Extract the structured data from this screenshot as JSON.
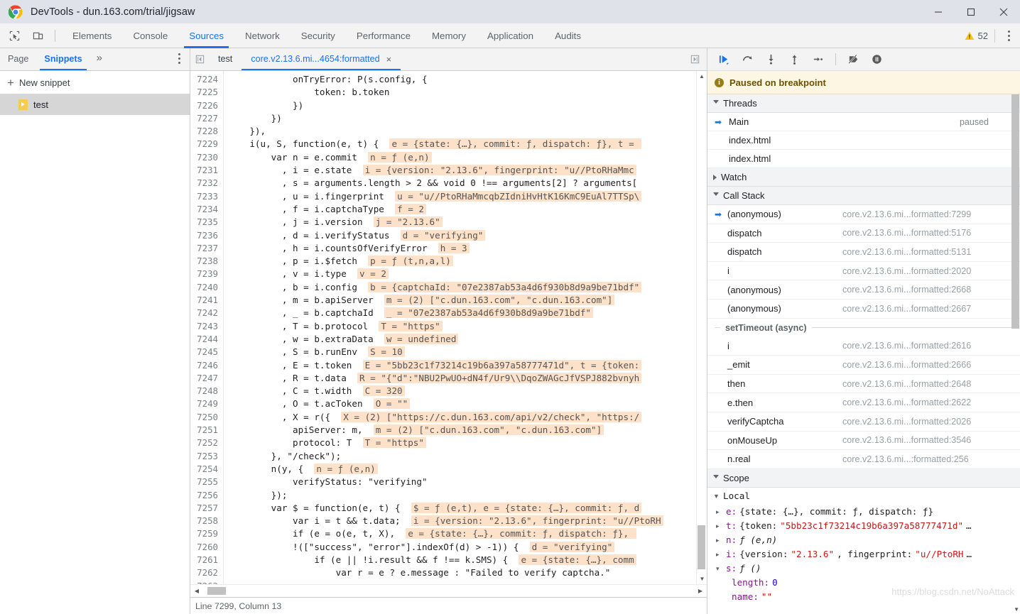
{
  "window": {
    "title": "DevTools - dun.163.com/trial/jigsaw",
    "controls": {
      "minimize": "minimize-icon",
      "maximize": "maximize-icon",
      "close": "close-icon"
    }
  },
  "devtools_tabs": {
    "icons": [
      "inspect-element-icon",
      "device-toolbar-icon"
    ],
    "items": [
      "Elements",
      "Console",
      "Sources",
      "Network",
      "Security",
      "Performance",
      "Memory",
      "Application",
      "Audits"
    ],
    "active": "Sources",
    "warning_count": "52",
    "warning_icon": "warning-triangle-icon",
    "more_icon": "kebab-menu-icon"
  },
  "navigator": {
    "tabs": [
      "Page",
      "Snippets"
    ],
    "active_tab": "Snippets",
    "more_tabs_label": "»",
    "new_snippet_label": "New snippet",
    "snippets": [
      "test"
    ]
  },
  "editor": {
    "tabs": [
      {
        "label": "test",
        "active": false,
        "closable": false
      },
      {
        "label": "core.v2.13.6.mi...4654:formatted",
        "active": true,
        "closable": true
      }
    ],
    "close_glyph": "×",
    "status": "Line 7299, Column 13",
    "first_line_number": 7224,
    "lines": [
      {
        "n": 7224,
        "code": "            onTryError: P(s.config, {"
      },
      {
        "n": 7225,
        "code": "                token: b.token"
      },
      {
        "n": 7226,
        "code": "            })"
      },
      {
        "n": 7227,
        "code": "        })"
      },
      {
        "n": 7228,
        "code": "    }),",
        "hint": ""
      },
      {
        "n": 7229,
        "code": "    i(u, S, function(e, t) {",
        "hint": "e = {state: {…}, commit: ƒ, dispatch: ƒ}, t = "
      },
      {
        "n": 7230,
        "code": "        var n = e.commit",
        "hint": "n = ƒ (e,n)"
      },
      {
        "n": 7231,
        "code": "          , i = e.state",
        "hint": "i = {version: \"2.13.6\", fingerprint: \"u//PtoRHaMmc"
      },
      {
        "n": 7232,
        "code": "          , s = arguments.length > 2 && void 0 !== arguments[2] ? arguments["
      },
      {
        "n": 7233,
        "code": "          , u = i.fingerprint",
        "hint": "u = \"u//PtoRHaMmcqbZIdniHvHtK16KmC9EuAl7TTSp\\"
      },
      {
        "n": 7234,
        "code": "          , f = i.captchaType",
        "hint": "f = 2"
      },
      {
        "n": 7235,
        "code": "          , j = i.version",
        "hint": "j = \"2.13.6\""
      },
      {
        "n": 7236,
        "code": "          , d = i.verifyStatus",
        "hint": "d = \"verifying\""
      },
      {
        "n": 7237,
        "code": "          , h = i.countsOfVerifyError",
        "hint": "h = 3"
      },
      {
        "n": 7238,
        "code": "          , p = i.$fetch",
        "hint": "p = ƒ (t,n,a,l)"
      },
      {
        "n": 7239,
        "code": "          , v = i.type",
        "hint": "v = 2"
      },
      {
        "n": 7240,
        "code": "          , b = i.config",
        "hint": "b = {captchaId: \"07e2387ab53a4d6f930b8d9a9be71bdf\""
      },
      {
        "n": 7241,
        "code": "          , m = b.apiServer",
        "hint": "m = (2) [\"c.dun.163.com\", \"c.dun.163.com\"]"
      },
      {
        "n": 7242,
        "code": "          , _ = b.captchaId",
        "hint": "_ = \"07e2387ab53a4d6f930b8d9a9be71bdf\""
      },
      {
        "n": 7243,
        "code": "          , T = b.protocol",
        "hint": "T = \"https\""
      },
      {
        "n": 7244,
        "code": "          , w = b.extraData",
        "hint": "w = undefined"
      },
      {
        "n": 7245,
        "code": "          , S = b.runEnv",
        "hint": "S = 10"
      },
      {
        "n": 7246,
        "code": "          , E = t.token",
        "hint": "E = \"5bb23c1f73214c19b6a397a58777471d\", t = {token:"
      },
      {
        "n": 7247,
        "code": "          , R = t.data",
        "hint": "R = \"{\"d\":\"NBU2PwUO+dN4f/Ur9\\\\DqoZWAGcJfVSPJ882bvnyh"
      },
      {
        "n": 7248,
        "code": "          , C = t.width",
        "hint": "C = 320"
      },
      {
        "n": 7249,
        "code": "          , O = t.acToken",
        "hint": "O = \"\""
      },
      {
        "n": 7250,
        "code": "          , X = r({",
        "hint": "X = (2) [\"https://c.dun.163.com/api/v2/check\", \"https:/"
      },
      {
        "n": 7251,
        "code": "            apiServer: m,",
        "hint": "m = (2) [\"c.dun.163.com\", \"c.dun.163.com\"]"
      },
      {
        "n": 7252,
        "code": "            protocol: T",
        "hint": "T = \"https\""
      },
      {
        "n": 7253,
        "code": "        }, \"/check\");"
      },
      {
        "n": 7254,
        "code": "        n(y, {",
        "hint": "n = ƒ (e,n)"
      },
      {
        "n": 7255,
        "code": "            verifyStatus: \"verifying\""
      },
      {
        "n": 7256,
        "code": "        });"
      },
      {
        "n": 7257,
        "code": "        var $ = function(e, t) {",
        "hint": "$ = ƒ (e,t), e = {state: {…}, commit: ƒ, d"
      },
      {
        "n": 7258,
        "code": "            var i = t && t.data;",
        "hint": "i = {version: \"2.13.6\", fingerprint: \"u//PtoRH"
      },
      {
        "n": 7259,
        "code": "            if (e = o(e, t, X),",
        "hint": "e = {state: {…}, commit: ƒ, dispatch: ƒ}, "
      },
      {
        "n": 7260,
        "code": "            !([\"success\", \"error\"].indexOf(d) > -1)) {",
        "hint": "d = \"verifying\""
      },
      {
        "n": 7261,
        "code": "                if (e || !i.result && f !== k.SMS) {",
        "hint": "e = {state: {…}, comm"
      },
      {
        "n": 7262,
        "code": "                    var r = e ? e.message : \"Failed to verify captcha.\""
      },
      {
        "n": 7263,
        "code": ""
      }
    ]
  },
  "debugger": {
    "toolbar_icons": [
      "resume-script-icon",
      "step-over-icon",
      "step-into-icon",
      "step-out-icon",
      "step-icon",
      "deactivate-breakpoints-icon",
      "pause-on-exceptions-icon"
    ],
    "paused_banner": "Paused on breakpoint",
    "paused_icon": "info-icon",
    "sections": {
      "threads": {
        "label": "Threads",
        "expanded": true,
        "items": [
          {
            "name": "Main",
            "status": "paused",
            "current": true
          },
          {
            "name": "index.html",
            "status": "",
            "current": false
          },
          {
            "name": "index.html",
            "status": "",
            "current": false
          }
        ]
      },
      "watch": {
        "label": "Watch",
        "expanded": false
      },
      "call_stack": {
        "label": "Call Stack",
        "expanded": true,
        "frames": [
          {
            "fn": "(anonymous)",
            "loc": "core.v2.13.6.mi...formatted:7299",
            "current": true
          },
          {
            "fn": "dispatch",
            "loc": "core.v2.13.6.mi...formatted:5176",
            "current": false
          },
          {
            "fn": "dispatch",
            "loc": "core.v2.13.6.mi...formatted:5131",
            "current": false
          },
          {
            "fn": "i",
            "loc": "core.v2.13.6.mi...formatted:2020",
            "current": false
          },
          {
            "fn": "(anonymous)",
            "loc": "core.v2.13.6.mi...formatted:2668",
            "current": false
          },
          {
            "fn": "(anonymous)",
            "loc": "core.v2.13.6.mi...formatted:2667",
            "current": false
          },
          {
            "async_label": "setTimeout (async)"
          },
          {
            "fn": "i",
            "loc": "core.v2.13.6.mi...formatted:2616",
            "current": false
          },
          {
            "fn": "_emit",
            "loc": "core.v2.13.6.mi...formatted:2666",
            "current": false
          },
          {
            "fn": "then",
            "loc": "core.v2.13.6.mi...formatted:2648",
            "current": false
          },
          {
            "fn": "e.then",
            "loc": "core.v2.13.6.mi...formatted:2622",
            "current": false
          },
          {
            "fn": "verifyCaptcha",
            "loc": "core.v2.13.6.mi...formatted:2026",
            "current": false
          },
          {
            "fn": "onMouseUp",
            "loc": "core.v2.13.6.mi...formatted:3546",
            "current": false
          },
          {
            "fn": "n.real",
            "loc": "core.v2.13.6.mi...:formatted:256",
            "current": false
          }
        ]
      },
      "scope": {
        "label": "Scope",
        "expanded": true,
        "local_label": "Local",
        "vars": [
          {
            "tw": "▸",
            "key": "e",
            "value": "{state: {…}, commit: ƒ, dispatch: ƒ}",
            "kind": "obj"
          },
          {
            "tw": "▸",
            "key": "t",
            "value": "{token: ",
            "string": "\"5bb23c1f73214c19b6a397a58777471d\"",
            "suffix": "…",
            "kind": "obj-str"
          },
          {
            "tw": "▸",
            "key": "n",
            "value": "ƒ (e,n)",
            "kind": "fn"
          },
          {
            "tw": "▸",
            "key": "i",
            "value": "{version: ",
            "string": "\"2.13.6\"",
            "mid": ", fingerprint: ",
            "string2": "\"u//PtoRH",
            "suffix": "…",
            "kind": "obj-str2"
          },
          {
            "tw": "▾",
            "key": "s",
            "value": "ƒ ()",
            "kind": "fn"
          },
          {
            "tw": "",
            "key": "length",
            "value": "0",
            "kind": "num",
            "indent": true
          },
          {
            "tw": "",
            "key": "name",
            "value": "\"\"",
            "kind": "str",
            "indent": true
          }
        ]
      }
    }
  },
  "watermark": "https://blog.csdn.net/NoAttack",
  "colors": {
    "accent": "#1a73e8",
    "hint_bg": "#fde1c8",
    "paused_bg": "#fdf6e3",
    "titlebar": "#dfe2e8",
    "toolbar": "#f3f3f3"
  }
}
